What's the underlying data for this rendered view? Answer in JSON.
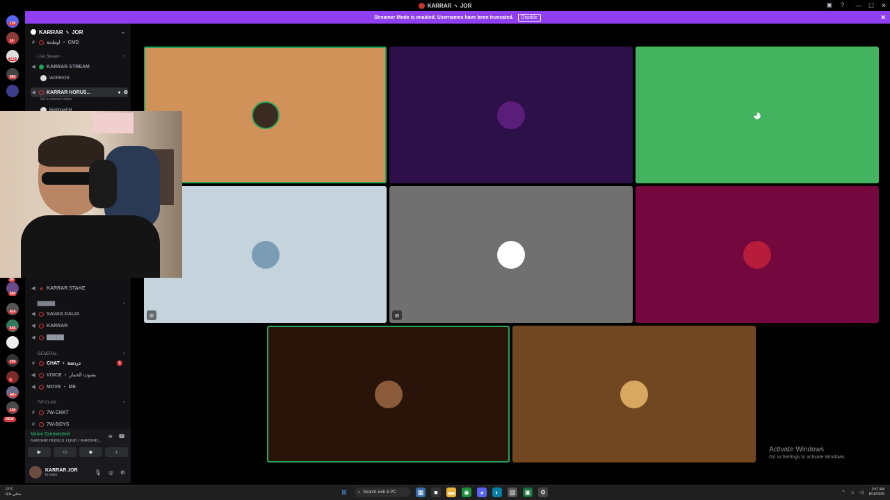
{
  "window": {
    "title": "KARRAR ヽ JOR",
    "controls": [
      "—",
      "☐",
      "✕"
    ],
    "toolbar_icons": [
      "inbox-icon",
      "help-icon"
    ]
  },
  "banner": {
    "text": "Streamer Mode is enabled. Usernames have been truncated.",
    "button": "Disable",
    "close": "✕"
  },
  "rail": {
    "badges": [
      "120",
      "14",
      "555",
      "493",
      "34",
      "360",
      "414",
      "545",
      "294",
      "1",
      "4K+",
      "160"
    ],
    "new_label": "NEW"
  },
  "sidebar": {
    "guild_name": "KARRAR ヽ JOR",
    "channels": {
      "top_partial": "لوطحة ・ CMD",
      "live_stream_cat": "· Live Stream ·",
      "karrar_stream": "KARRAR STREAM",
      "warrior": "WARRIOR",
      "karrar_horus": "KARRAR HORUS...",
      "set_status": "Set a channel status",
      "member_bigshow": "BigShowFM",
      "karrar_stake": "KARRAR STAKE",
      "cat2": "· ██████ ·",
      "savag_dalia": "SAVAG DALIA",
      "karrar": "KARRAR",
      "blocked": "█████",
      "general_cat": "· GENERAL ·",
      "chat": "CHAT ・ دردشة",
      "chat_unread": "1",
      "voice": "VOICE ・ بصوت الحمار",
      "move_me": "MOVE ・ ME",
      "clan_cat": "· 7W CLAN ·",
      "w_chat": "7W-CHAT",
      "w_boys": "7W-BOYS"
    },
    "voice_panel": {
      "status": "Voice Connected",
      "channel": "KARRAR HORUS TOUR / KARRAR...",
      "buttons": [
        "camera-icon",
        "screen-share-icon",
        "activity-icon",
        "soundboard-icon"
      ]
    },
    "user": {
      "name": "KARRAR JOR",
      "status": "In voice"
    }
  },
  "stage": {
    "tiles": [
      {
        "color": "#d1925a",
        "avatar": "#3a2a20",
        "speaking": true
      },
      {
        "color": "#2d0f4a",
        "avatar": "#5a1e7a",
        "speaking": false
      },
      {
        "color": "#44b35f",
        "avatar": "discord",
        "speaking": false
      },
      {
        "color": "#c5d4dc",
        "avatar": "#7a9db5",
        "speaking": false,
        "muted": true
      },
      {
        "color": "#707070",
        "avatar": "#ffffff",
        "speaking": false,
        "muted": true
      },
      {
        "color": "#73073e",
        "avatar": "#b71c3a",
        "speaking": false
      },
      {
        "color": "#2a1309",
        "avatar": "#8a5a3a",
        "speaking": true
      },
      {
        "color": "#704721",
        "avatar": "#d9a860",
        "speaking": false
      }
    ]
  },
  "activate": {
    "title": "Activate Windows",
    "sub": "Go to Settings to activate Windows."
  },
  "taskbar": {
    "temp": "27°C",
    "weather": "صافي غالبًا",
    "search": "Search web & PC",
    "time": "3:57 AM",
    "date": "8/16/2025"
  }
}
